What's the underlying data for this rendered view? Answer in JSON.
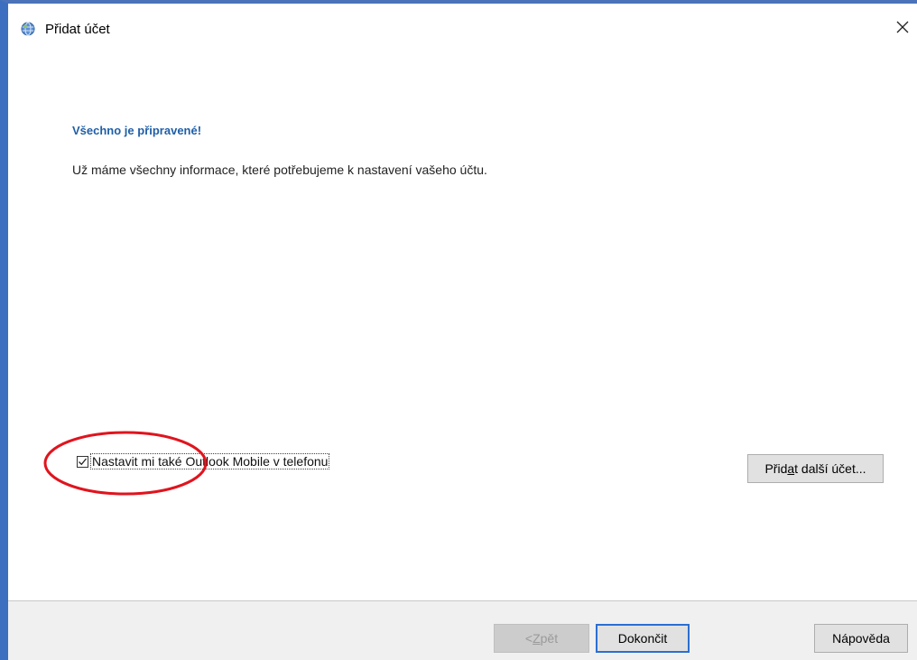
{
  "window": {
    "title": "Přidat účet",
    "icon": "outlook-globe-icon",
    "close_icon": "close-icon"
  },
  "main": {
    "heading": "Všechno je připravené!",
    "info": "Už máme všechny informace, které potřebujeme k nastavení vašeho účtu.",
    "mobile_checkbox": {
      "checked": true,
      "label": "Nastavit mi také Outlook Mobile v telefonu"
    },
    "add_account_button": {
      "label_pre": "Přid",
      "label_key": "a",
      "label_post": "t další účet..."
    }
  },
  "footer": {
    "back_button": {
      "label_pre": "< ",
      "label_key": "Z",
      "label_post": "pět",
      "enabled": false
    },
    "finish_button": {
      "label": "Dokončit",
      "default": true
    },
    "help_button": {
      "label": "Nápověda"
    }
  },
  "colors": {
    "heading": "#1f5fa8",
    "window_border": "#3d6fc0",
    "highlight": "#e0141e",
    "footer_bg": "#f0f0f0"
  }
}
